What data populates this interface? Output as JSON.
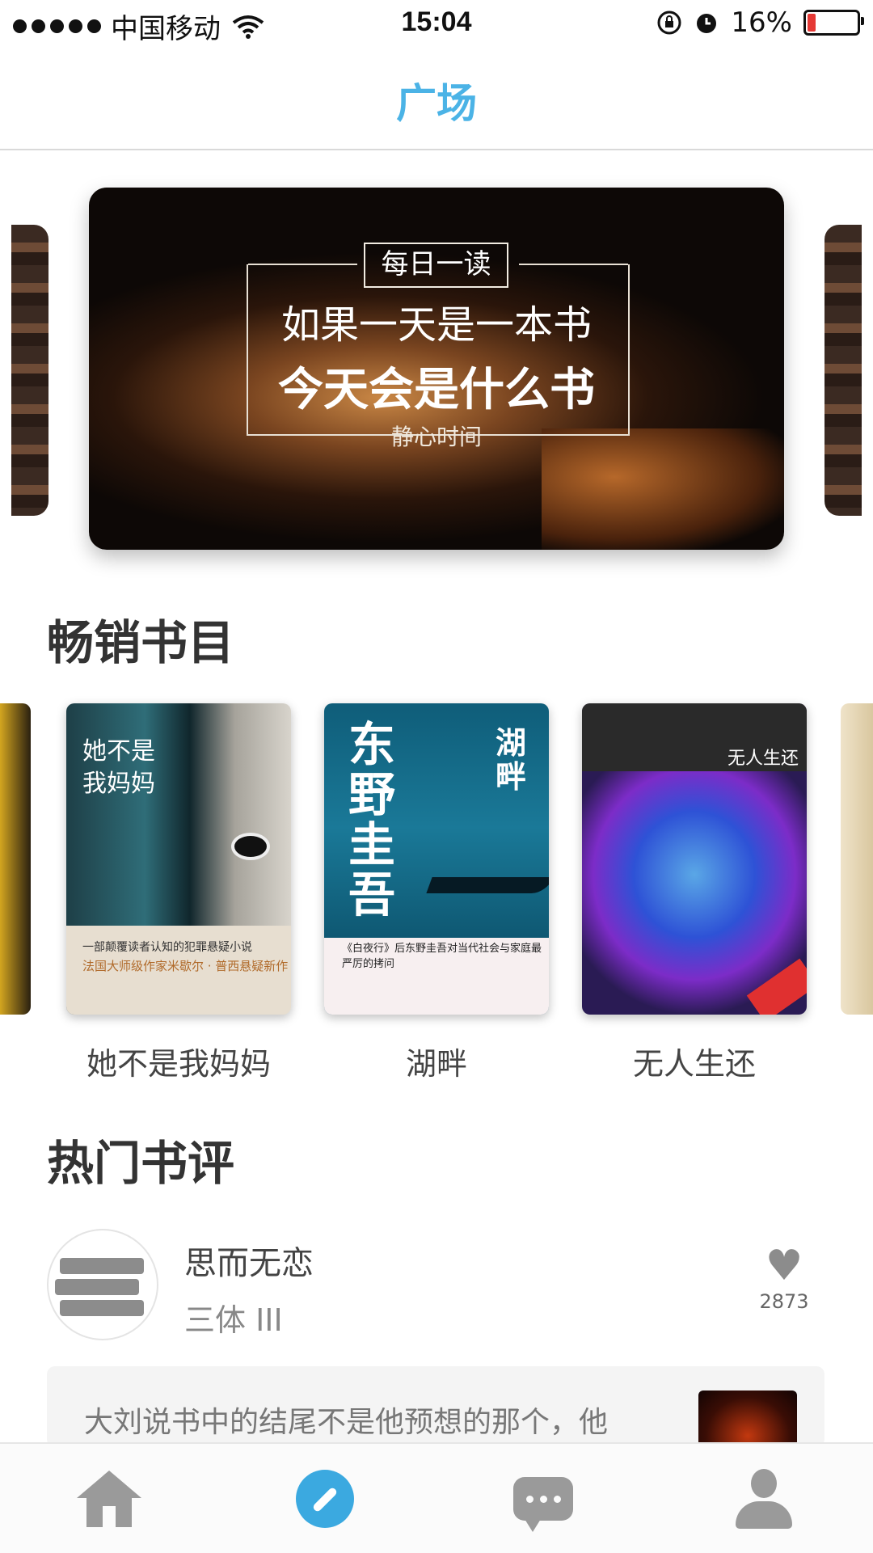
{
  "status_bar": {
    "carrier": "中国移动",
    "time": "15:04",
    "battery": "16%",
    "battery_level": 0.16,
    "icons": [
      "signal-dots-icon",
      "wifi-icon",
      "rotation-lock-icon",
      "alarm-icon",
      "battery-icon"
    ]
  },
  "nav": {
    "title": "广场"
  },
  "banner": {
    "tag": "每日一读",
    "line1": "如果一天是一本书",
    "line2": "今天会是什么书",
    "subtitle": "静心时间"
  },
  "bestsellers": {
    "heading": "畅销书目",
    "books": [
      {
        "title": "她不是我妈妈",
        "cover_title": "她不是我妈妈",
        "cover_line1": "一部颠覆读者认知的犯罪悬疑小说",
        "cover_line2": "法国大师级作家米歇尔 · 普西悬疑新作"
      },
      {
        "title": "湖畔",
        "cover_author": "东野圭吾",
        "cover_title": "湖畔",
        "cover_line1": "《白夜行》后东野圭吾对当代社会与家庭最严厉的拷问"
      },
      {
        "title": "无人生还",
        "cover_title": "无人生还"
      }
    ]
  },
  "reviews": {
    "heading": "热门书评",
    "items": [
      {
        "user": "思而无恋",
        "book": "三体 III",
        "likes": "2873",
        "excerpt": "大刘说书中的结尾不是他预想的那个，他"
      }
    ]
  },
  "tabbar": {
    "tabs": [
      {
        "icon": "home-icon",
        "active": false
      },
      {
        "icon": "compass-icon",
        "active": true
      },
      {
        "icon": "chat-icon",
        "active": false
      },
      {
        "icon": "user-icon",
        "active": false
      }
    ]
  },
  "colors": {
    "accent": "#4bb3e6",
    "tab_inactive": "#9a9a9a"
  }
}
